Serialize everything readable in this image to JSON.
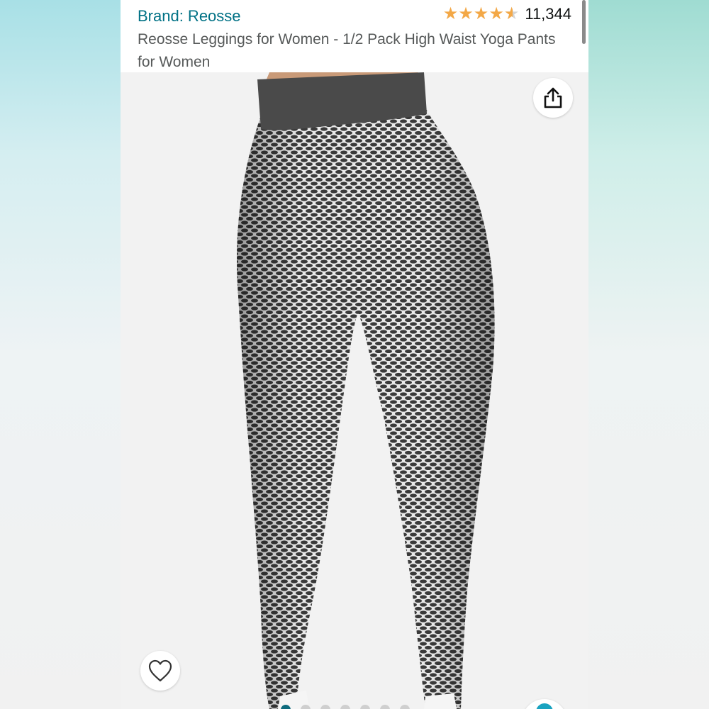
{
  "product": {
    "brand_label": "Brand: Reosse",
    "rating": 4.5,
    "rating_out_of": 5,
    "rating_count": "11,344",
    "title": "Reosse Leggings for Women - 1/2 Pack High Waist Yoga Pants for Women"
  },
  "gallery": {
    "image_count": 7,
    "active_index": 0
  },
  "icons": {
    "share": "share-icon",
    "wishlist": "heart-icon",
    "star": "star-icon",
    "visual_search": "camera-lens-icon"
  },
  "colors": {
    "brand_link": "#007185",
    "star": "#f3a847",
    "active_dot": "#0f6b7d"
  }
}
